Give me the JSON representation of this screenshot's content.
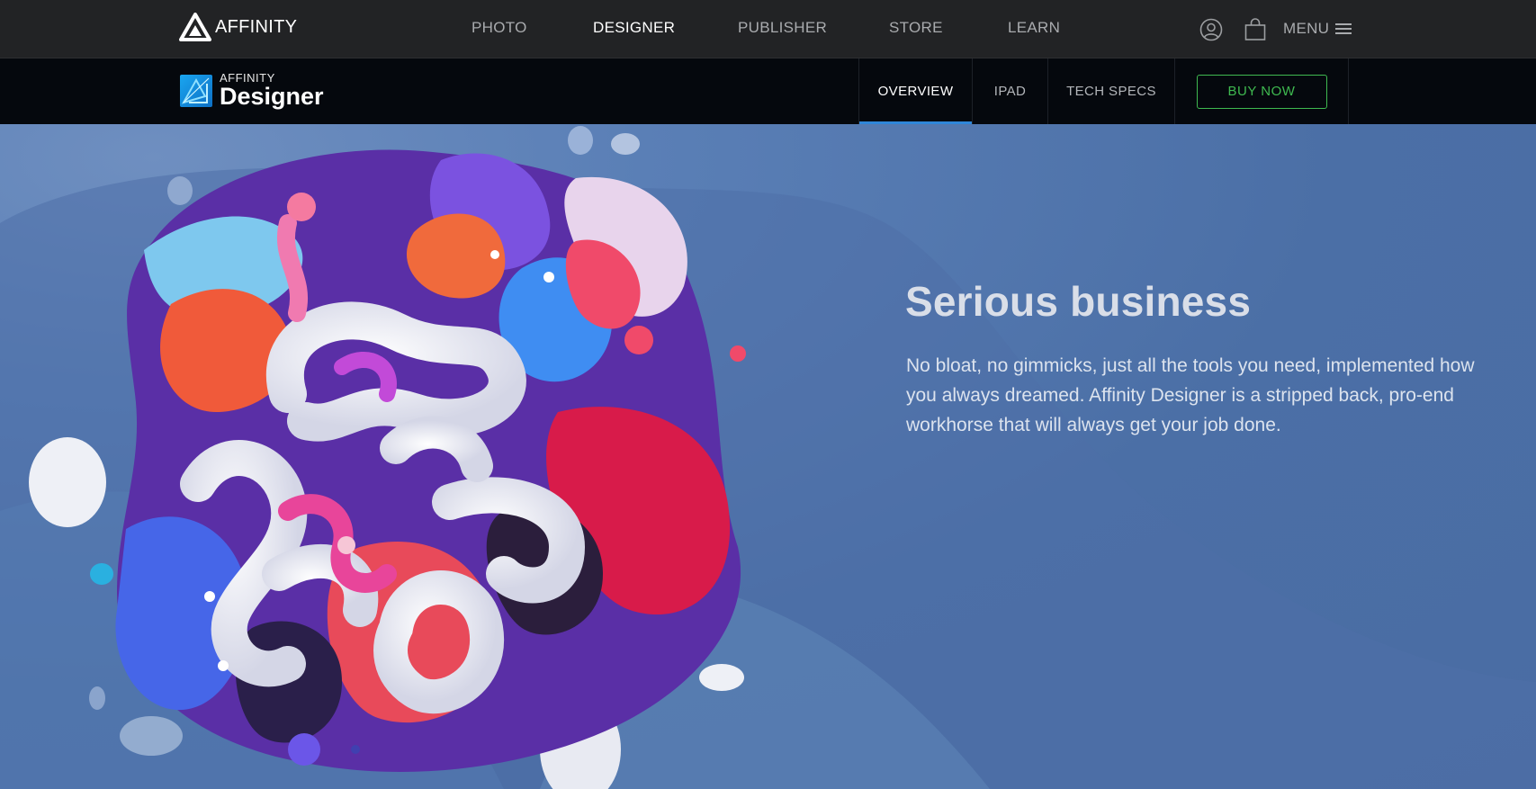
{
  "global_nav": {
    "brand": "AFFINITY",
    "links": [
      {
        "label": "PHOTO",
        "active": false
      },
      {
        "label": "DESIGNER",
        "active": true
      },
      {
        "label": "PUBLISHER",
        "active": false
      },
      {
        "label": "STORE",
        "active": false
      },
      {
        "label": "LEARN",
        "active": false
      }
    ],
    "account_icon": "user-circle-icon",
    "cart_icon": "shopping-bag-icon",
    "menu_label": "MENU",
    "menu_icon": "hamburger-icon"
  },
  "product_nav": {
    "suite": "AFFINITY",
    "product": "Designer",
    "tabs": [
      {
        "label": "OVERVIEW",
        "active": true
      },
      {
        "label": "IPAD",
        "active": false
      },
      {
        "label": "TECH SPECS",
        "active": false
      }
    ],
    "buy_label": "BUY NOW"
  },
  "hero": {
    "title": "Serious business",
    "body": "No bloat, no gimmicks, just all the tools you need, implemented how you always dreamed. Affinity Designer is a stripped back, pro-end workhorse that will always get your job done."
  },
  "colors": {
    "nav_bg": "#222325",
    "subnav_bg": "#05080d",
    "accent_blue": "#2f86d8",
    "buy_green": "#3fb950",
    "hero_bg": "#4f73a8"
  }
}
